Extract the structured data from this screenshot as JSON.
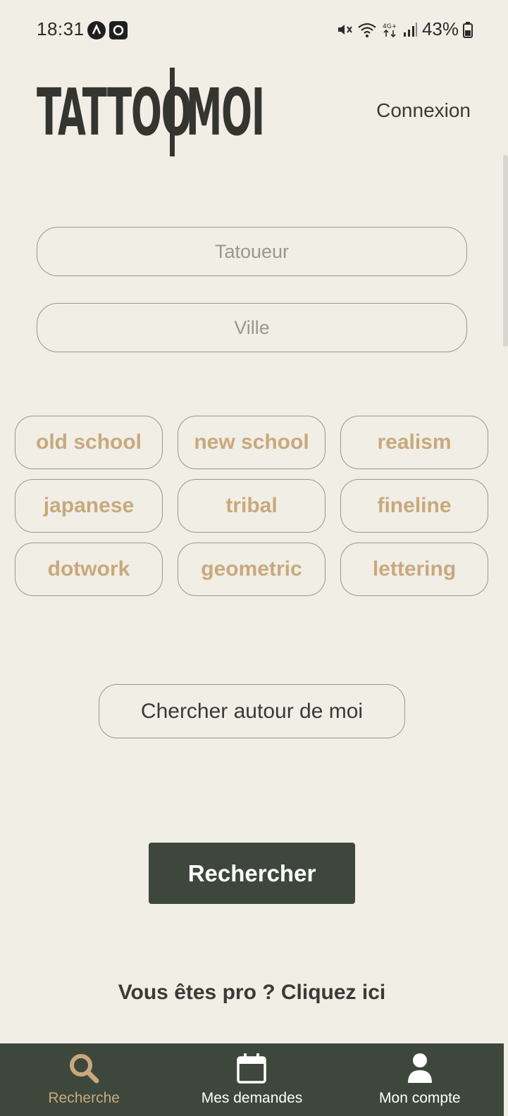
{
  "status_bar": {
    "time": "18:31",
    "battery": "43%",
    "icons": [
      "app-a-icon",
      "app-camera-icon",
      "mute-icon",
      "wifi-icon",
      "4g-icon",
      "signal-icon",
      "battery-icon"
    ]
  },
  "header": {
    "logo_left": "TATTOO",
    "logo_right": "MOI",
    "login_label": "Connexion"
  },
  "search": {
    "tattooer_placeholder": "Tatoueur",
    "city_placeholder": "Ville"
  },
  "styles": [
    "old school",
    "new school",
    "realism",
    "japanese",
    "tribal",
    "fineline",
    "dotwork",
    "geometric",
    "lettering"
  ],
  "around_me_label": "Chercher autour de moi",
  "search_button_label": "Rechercher",
  "pro_link_label": "Vous êtes pro ? Cliquez ici",
  "bottom_nav": {
    "items": [
      {
        "label": "Recherche",
        "icon": "search-icon",
        "active": true
      },
      {
        "label": "Mes demandes",
        "icon": "calendar-icon",
        "active": false
      },
      {
        "label": "Mon compte",
        "icon": "user-icon",
        "active": false
      }
    ]
  },
  "colors": {
    "background": "#f1eee6",
    "accent": "#c8a97c",
    "primary": "#3e473c",
    "text": "#3a3a36"
  }
}
